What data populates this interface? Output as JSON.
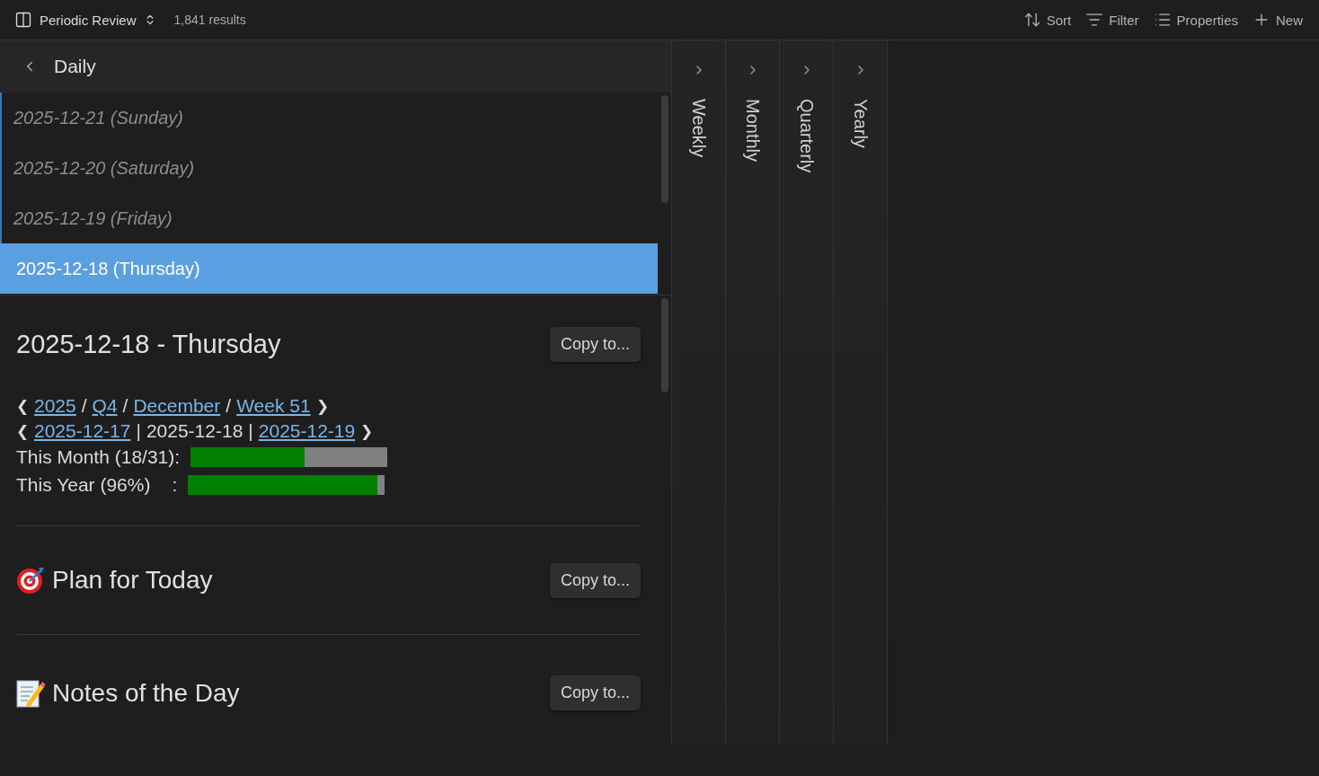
{
  "toolbar": {
    "view_name": "Periodic Review",
    "results": "1,841 results",
    "actions": [
      {
        "kind": "sort",
        "label": "Sort"
      },
      {
        "kind": "filter",
        "label": "Filter"
      },
      {
        "kind": "properties",
        "label": "Properties"
      },
      {
        "kind": "new",
        "label": "New"
      }
    ]
  },
  "daily_panel": {
    "title": "Daily",
    "entries": [
      {
        "label": "2025-12-21 (Sunday)",
        "selected": false
      },
      {
        "label": "2025-12-20 (Saturday)",
        "selected": false
      },
      {
        "label": "2025-12-19 (Friday)",
        "selected": false
      },
      {
        "label": "2025-12-18 (Thursday)",
        "selected": true
      }
    ],
    "note": {
      "title": "2025-12-18 - Thursday",
      "copy_button": "Copy to...",
      "breadcrumb": [
        {
          "kind": "arrow",
          "text": "❮"
        },
        {
          "kind": "link",
          "text": "2025"
        },
        {
          "kind": "text",
          "text": "/"
        },
        {
          "kind": "link",
          "text": "Q4"
        },
        {
          "kind": "text",
          "text": "/"
        },
        {
          "kind": "link",
          "text": "December"
        },
        {
          "kind": "text",
          "text": "/"
        },
        {
          "kind": "link",
          "text": "Week 51"
        },
        {
          "kind": "arrow",
          "text": "❯"
        }
      ],
      "day_nav": [
        {
          "kind": "arrow",
          "text": "❮"
        },
        {
          "kind": "link",
          "text": "2025-12-17"
        },
        {
          "kind": "text",
          "text": "|"
        },
        {
          "kind": "text",
          "text": "2025-12-18"
        },
        {
          "kind": "text",
          "text": "|"
        },
        {
          "kind": "link",
          "text": "2025-12-19"
        },
        {
          "kind": "arrow",
          "text": "❯"
        }
      ],
      "progress": [
        {
          "label": "This Month (18/31):",
          "level": 0.58
        },
        {
          "label": "This Year (96%)",
          "colon": ":",
          "level": 0.96
        }
      ],
      "sections": [
        {
          "kind": "target",
          "title": "Plan for Today",
          "copy_button": "Copy to..."
        },
        {
          "kind": "memo",
          "title": "Notes of the Day",
          "copy_button": "Copy to..."
        }
      ]
    }
  },
  "collapsed_panels": [
    {
      "title": "Weekly"
    },
    {
      "title": "Monthly"
    },
    {
      "title": "Quarterly"
    },
    {
      "title": "Yearly"
    }
  ]
}
